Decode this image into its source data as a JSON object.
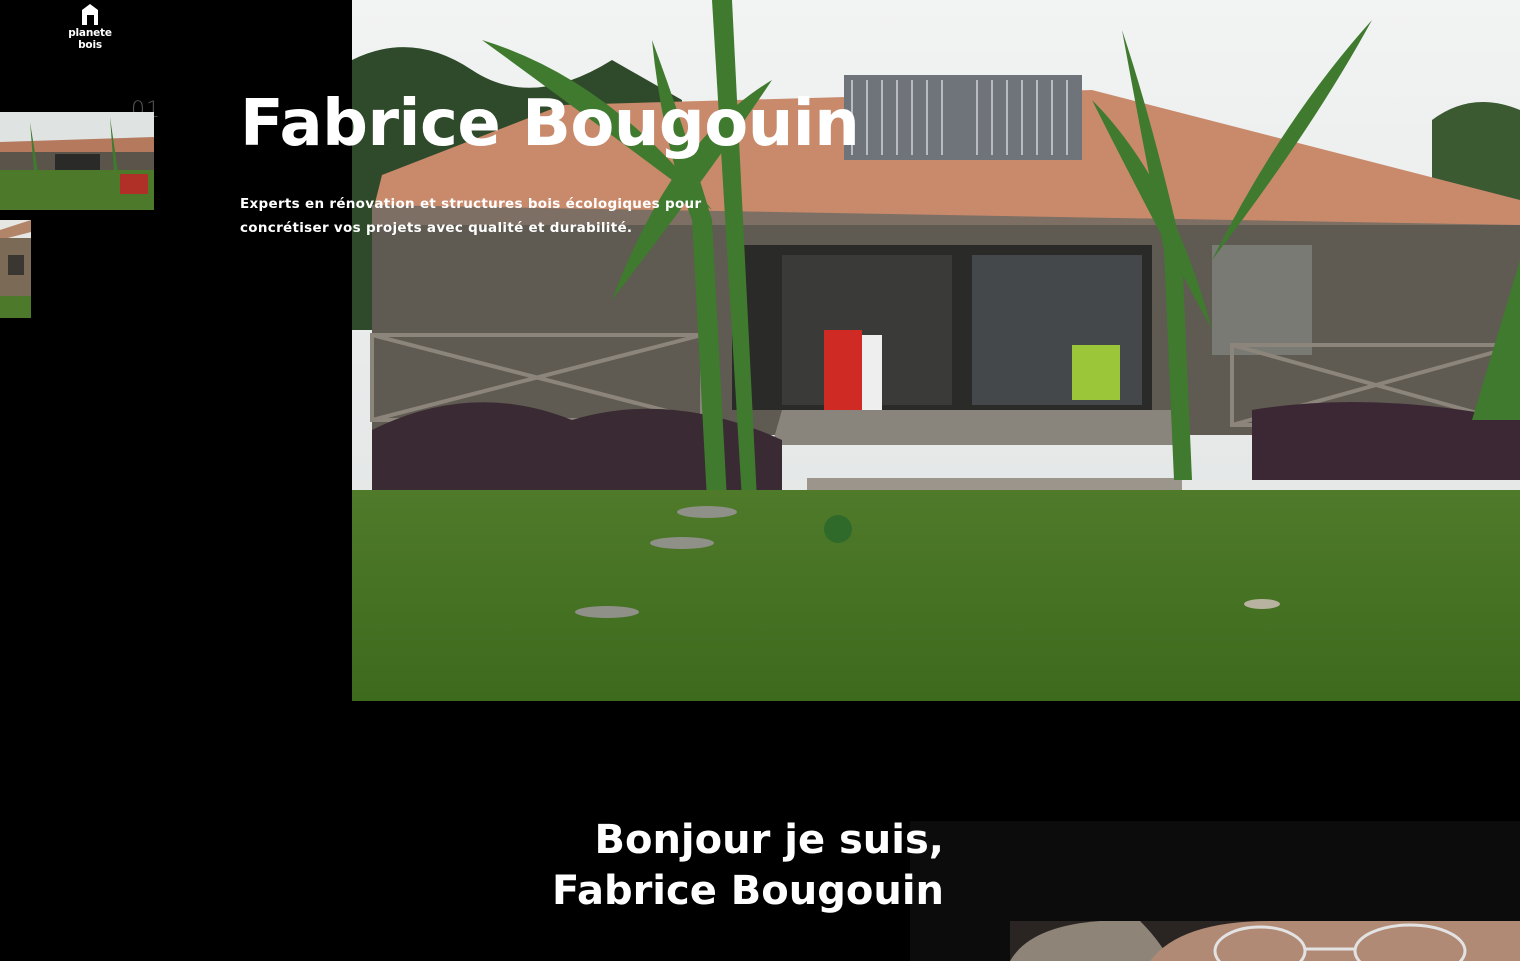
{
  "brand": {
    "name": "planete bois"
  },
  "hero": {
    "title": "Fabrice Bougouin",
    "subtitle": "Experts en rénovation et structures bois écologiques pour concrétiser vos projets avec qualité et durabilité.",
    "slide_number": "01"
  },
  "intro": {
    "line1": "Bonjour je suis,",
    "line2": "Fabrice Bougouin"
  },
  "colors": {
    "background": "#000000",
    "text": "#ffffff",
    "panel": "#0c0c0c"
  }
}
